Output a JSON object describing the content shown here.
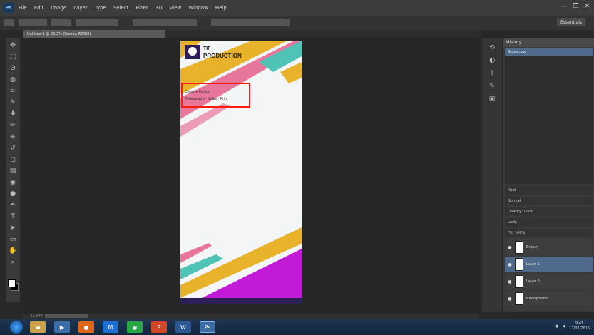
{
  "app": {
    "logo": "Ps"
  },
  "menubar": {
    "items": [
      "File",
      "Edit",
      "Image",
      "Layer",
      "Type",
      "Select",
      "Filter",
      "3D",
      "View",
      "Window",
      "Help"
    ]
  },
  "window_controls": [
    "—",
    "❐",
    "✕"
  ],
  "options_bar": {
    "workspace": "Essentials"
  },
  "document_tab": {
    "label": "Untitled-1 @ 33.3% (Brosur, RGB/8)"
  },
  "toolbar": {
    "icons": [
      "move-icon",
      "marquee-icon",
      "lasso-icon",
      "quick-select-icon",
      "crop-icon",
      "eyedropper-icon",
      "healing-icon",
      "brush-icon",
      "stamp-icon",
      "history-brush-icon",
      "eraser-icon",
      "gradient-icon",
      "blur-icon",
      "dodge-icon",
      "pen-icon",
      "type-icon",
      "path-select-icon",
      "shape-icon",
      "hand-icon",
      "zoom-icon"
    ],
    "glyphs": [
      "✥",
      "⬚",
      "ʘ",
      "◍",
      "⌗",
      "✎",
      "✚",
      "✏",
      "⎈",
      "↺",
      "◻",
      "▤",
      "◉",
      "●",
      "✒",
      "T",
      "➤",
      "▭",
      "✋",
      "⌕"
    ]
  },
  "document": {
    "title_line1": "TIF",
    "title_line2": "PRODUCTION",
    "text_line1": "Creative Design",
    "text_line2": "Photography · Video · Print",
    "colors": {
      "pink": "#e8769a",
      "yellow": "#e8b22a",
      "teal": "#4fc3b5",
      "purple": "#c21ad6",
      "dark": "#2c1f5a"
    }
  },
  "status": {
    "zoom": "33.33%"
  },
  "right_strip": {
    "icons": [
      "history-icon",
      "color-icon",
      "paths-icon",
      "brush-preset-icon",
      "adjust-icon"
    ],
    "glyphs": [
      "⟲",
      "◐",
      "⌇",
      "✎",
      "▣"
    ]
  },
  "panel": {
    "header": "History",
    "history_item": "Brosur.psd",
    "layers_controls": [
      "Kind",
      "Normal",
      "Opacity: 100%",
      "Lock:",
      "Fill: 100%"
    ],
    "layers": [
      {
        "name": "Brosur",
        "active": false
      },
      {
        "name": "Layer 1",
        "active": true
      },
      {
        "name": "Layer 0",
        "active": false
      },
      {
        "name": "Background",
        "active": false
      }
    ]
  },
  "taskbar": {
    "apps": [
      {
        "name": "explorer",
        "glyph": "▬",
        "color": "#c9a24a",
        "active": false
      },
      {
        "name": "media",
        "glyph": "▶",
        "color": "#3b6ea8",
        "active": false
      },
      {
        "name": "firefox",
        "glyph": "●",
        "color": "#e0661c",
        "active": false
      },
      {
        "name": "mail",
        "glyph": "M",
        "color": "#1e6fd1",
        "active": false
      },
      {
        "name": "chrome",
        "glyph": "◉",
        "color": "#28a745",
        "active": false
      },
      {
        "name": "ppt",
        "glyph": "P",
        "color": "#d24726",
        "active": false
      },
      {
        "name": "word",
        "glyph": "W",
        "color": "#2b5797",
        "active": false
      },
      {
        "name": "photoshop",
        "glyph": "Ps",
        "color": "#1b3a5c",
        "active": true
      }
    ],
    "clock_time": "9:41",
    "clock_date": "12/03/2016"
  }
}
